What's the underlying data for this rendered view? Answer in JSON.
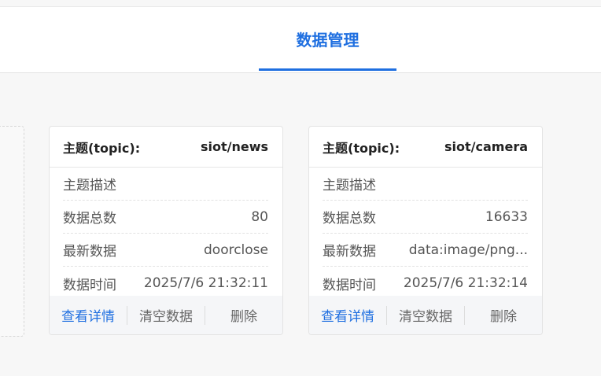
{
  "header": {
    "active_tab": "数据管理"
  },
  "cards": [
    {
      "topic_label": "主题(topic):",
      "topic": "siot/news",
      "rows": [
        {
          "label": "主题描述",
          "value": ""
        },
        {
          "label": "数据总数",
          "value": "80"
        },
        {
          "label": "最新数据",
          "value": "doorclose"
        },
        {
          "label": "数据时间",
          "value": "2025/7/6 21:32:11"
        }
      ],
      "actions": {
        "view": "查看详情",
        "clear": "清空数据",
        "delete": "删除"
      }
    },
    {
      "topic_label": "主题(topic):",
      "topic": "siot/camera",
      "rows": [
        {
          "label": "主题描述",
          "value": ""
        },
        {
          "label": "数据总数",
          "value": "16633"
        },
        {
          "label": "最新数据",
          "value": "data:image/png..."
        },
        {
          "label": "数据时间",
          "value": "2025/7/6 21:32:14"
        }
      ],
      "actions": {
        "view": "查看详情",
        "clear": "清空数据",
        "delete": "删除"
      }
    }
  ],
  "colors": {
    "accent": "#1f6fe0",
    "background": "#f7f7f7"
  }
}
